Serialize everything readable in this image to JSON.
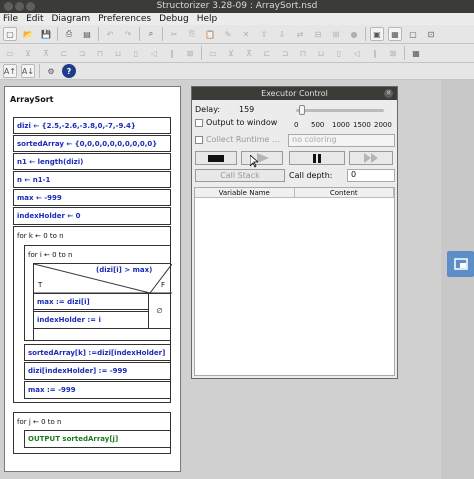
{
  "window": {
    "title": "Structorizer 3.28-09 : ArraySort.nsd"
  },
  "menu": [
    "File",
    "Edit",
    "Diagram",
    "Preferences",
    "Debug",
    "Help"
  ],
  "toolbar": {
    "font_up": "A↑",
    "font_down": "A↓"
  },
  "diagram": {
    "name": "ArraySort",
    "s1": "dizi ← {2.5,-2.6,-3.8,0,-7,-9.4}",
    "s2": "sortedArray ← {0,0,0,0,0,0,0,0,0,0}",
    "s3": "n1 ← length(dizi)",
    "s4": "n ← n1-1",
    "s5": "max ← -999",
    "s6": "indexHolder ← 0",
    "for1": "for k ← 0 to n",
    "for2": "for i ← 0 to n",
    "cond": "(dizi[i] > max)",
    "t": "T",
    "f": "F",
    "s7": "max := dizi[i]",
    "s8": "indexHolder := i",
    "empty": "∅",
    "s9": "sortedArray[k] :=dizi[indexHolder]",
    "s10": "dizi[indexHolder] := -999",
    "s11": "max := -999",
    "for3": "for j ← 0 to n",
    "out": "OUTPUT sortedArray[j]"
  },
  "executor": {
    "title": "Executor Control",
    "delay_label": "Delay:",
    "delay_value": "159",
    "output_label": "Output to window",
    "collect_label": "Collect Runtime ...",
    "coloring": "no coloring",
    "ticks": [
      "0",
      "500",
      "1000",
      "1500",
      "2000"
    ],
    "callstack": "Call Stack",
    "calldepth_label": "Call depth:",
    "calldepth_value": "0",
    "col_name": "Variable Name",
    "col_content": "Content"
  }
}
